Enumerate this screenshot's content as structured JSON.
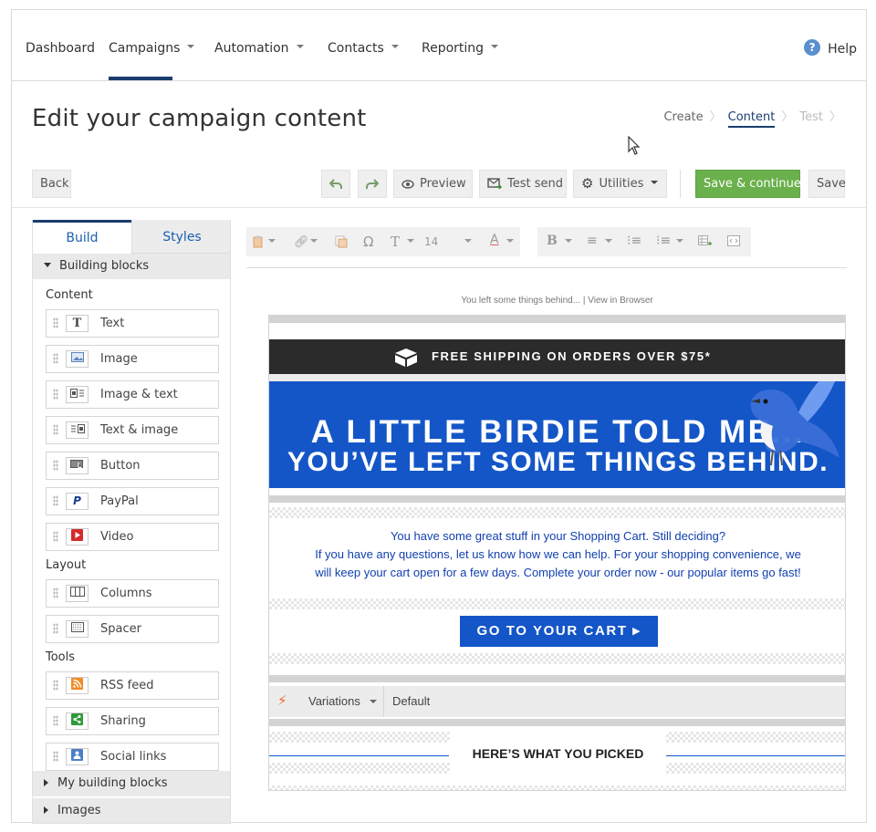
{
  "nav": {
    "items": [
      "Dashboard",
      "Campaigns",
      "Automation",
      "Contacts",
      "Reporting"
    ],
    "help_label": "Help",
    "active": "Campaigns"
  },
  "header": {
    "title": "Edit your campaign content",
    "steps": [
      "Create",
      "Content",
      "Test"
    ],
    "current_step": "Content"
  },
  "toolbar": {
    "back_label": "Back",
    "preview_label": "Preview",
    "test_send_label": "Test send",
    "utilities_label": "Utilities",
    "save_continue_label": "Save & continue",
    "save_label": "Save",
    "accent_color": "#6ab04c"
  },
  "panel": {
    "tabs": [
      "Build",
      "Styles"
    ],
    "building_blocks_label": "Building blocks",
    "groups": {
      "content_label": "Content",
      "layout_label": "Layout",
      "tools_label": "Tools"
    },
    "content_blocks": [
      {
        "label": "Text",
        "icon": "text-icon"
      },
      {
        "label": "Image",
        "icon": "image-icon"
      },
      {
        "label": "Image & text",
        "icon": "image-text-icon"
      },
      {
        "label": "Text & image",
        "icon": "text-image-icon"
      },
      {
        "label": "Button",
        "icon": "button-icon"
      },
      {
        "label": "PayPal",
        "icon": "paypal-icon"
      },
      {
        "label": "Video",
        "icon": "video-icon"
      }
    ],
    "layout_blocks": [
      {
        "label": "Columns",
        "icon": "columns-icon"
      },
      {
        "label": "Spacer",
        "icon": "spacer-icon"
      }
    ],
    "tool_blocks": [
      {
        "label": "RSS feed",
        "icon": "rss-icon"
      },
      {
        "label": "Sharing",
        "icon": "sharing-icon"
      },
      {
        "label": "Social links",
        "icon": "social-links-icon"
      }
    ],
    "my_blocks_label": "My building blocks",
    "images_label": "Images"
  },
  "editor": {
    "font_size": "14"
  },
  "email": {
    "preheader": "You left some things behind... | View in Browser",
    "shipping_banner": "FREE SHIPPING ON ORDERS OVER $75*",
    "hero_line1": "A LITTLE BIRDIE TOLD ME...",
    "hero_line2": "YOU’VE LEFT SOME THINGS BEHIND.",
    "body_line1": "You have some great stuff in your Shopping Cart. Still deciding?",
    "body_line2": "If you have any questions, let us know how we can help. For your shopping convenience, we",
    "body_line3": "will keep your cart open for a few days. Complete your order now - our popular items go fast!",
    "cart_button": "GO TO YOUR CART ▸",
    "variations_label": "Variations",
    "variations_value": "Default",
    "picked_heading": "HERE’S WHAT YOU PICKED",
    "brand_color": "#1456c7"
  }
}
